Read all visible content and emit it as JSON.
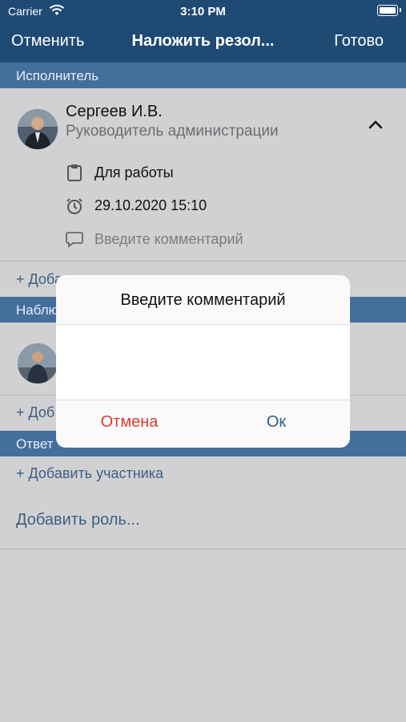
{
  "status_bar": {
    "carrier": "Carrier",
    "time": "3:10 PM"
  },
  "nav": {
    "cancel": "Отменить",
    "title": "Наложить резол...",
    "done": "Готово"
  },
  "sections": {
    "executor": "Исполнитель",
    "observer": "Наблю",
    "responsible": "Ответ"
  },
  "executor": {
    "name": "Сергеев И.В.",
    "role": "Руководитель администрации",
    "purpose": "Для работы",
    "deadline": "29.10.2020 15:10",
    "comment_placeholder": "Введите комментарий"
  },
  "links": {
    "add_partial_1": "+ Доба",
    "add_partial_2": "+ Доб",
    "add_participant": "+ Добавить участника",
    "add_role": "Добавить роль..."
  },
  "dialog": {
    "title": "Введите комментарий",
    "cancel": "Отмена",
    "ok": "Ок"
  },
  "icons": {
    "wifi": "wifi-icon",
    "battery": "battery-icon",
    "collapse": "chevron-up-icon",
    "purpose": "clipboard-icon",
    "deadline": "alarm-clock-icon",
    "comment": "speech-bubble-icon"
  }
}
